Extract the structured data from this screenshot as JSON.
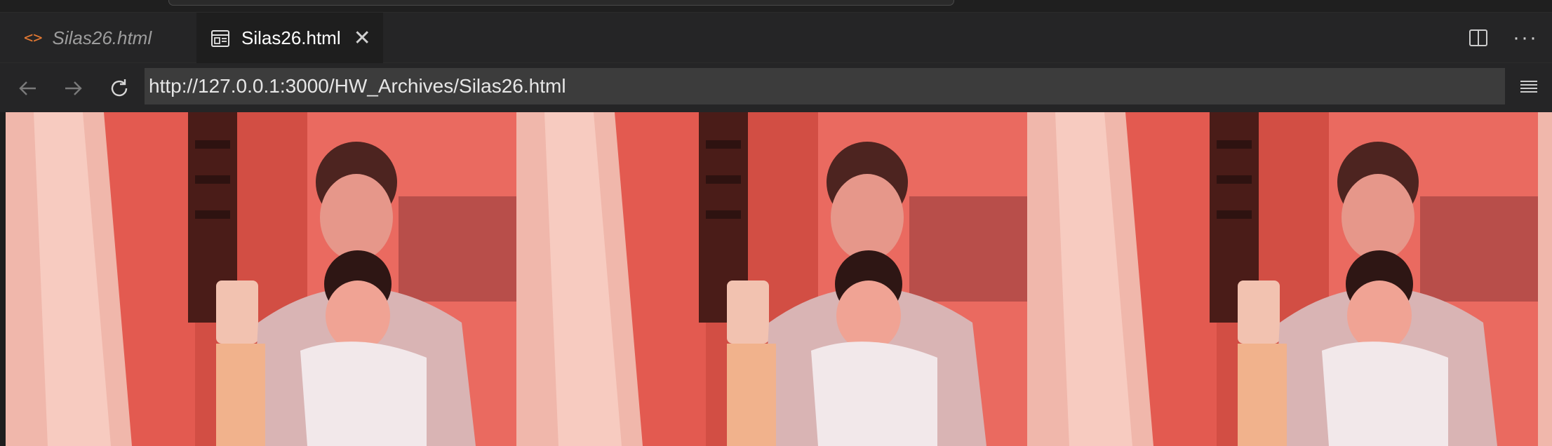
{
  "tabs": [
    {
      "label": "Silas26.html",
      "kind": "code",
      "state": "preview",
      "icon": "code-icon"
    },
    {
      "label": "Silas26.html",
      "kind": "web-preview",
      "state": "active",
      "icon": "browser-preview-icon"
    }
  ],
  "toolbar_actions": {
    "split": "split-editor-icon",
    "more": "more-actions-icon"
  },
  "navigation": {
    "back_icon": "arrow-left-icon",
    "forward_icon": "arrow-right-icon",
    "reload_icon": "reload-icon",
    "url": "http://127.0.0.1:3000/HW_Archives/Silas26.html",
    "menu_icon": "hamburger-menu-icon"
  },
  "content": {
    "photos": [
      {
        "description": "photo-1"
      },
      {
        "description": "photo-2"
      },
      {
        "description": "photo-3"
      }
    ]
  },
  "colors": {
    "tabbar_bg": "#252526",
    "active_tab_bg": "#1e1e1e",
    "url_bg": "#3c3c3c",
    "code_icon": "#e37933",
    "photo_tint": "#e85a50"
  }
}
